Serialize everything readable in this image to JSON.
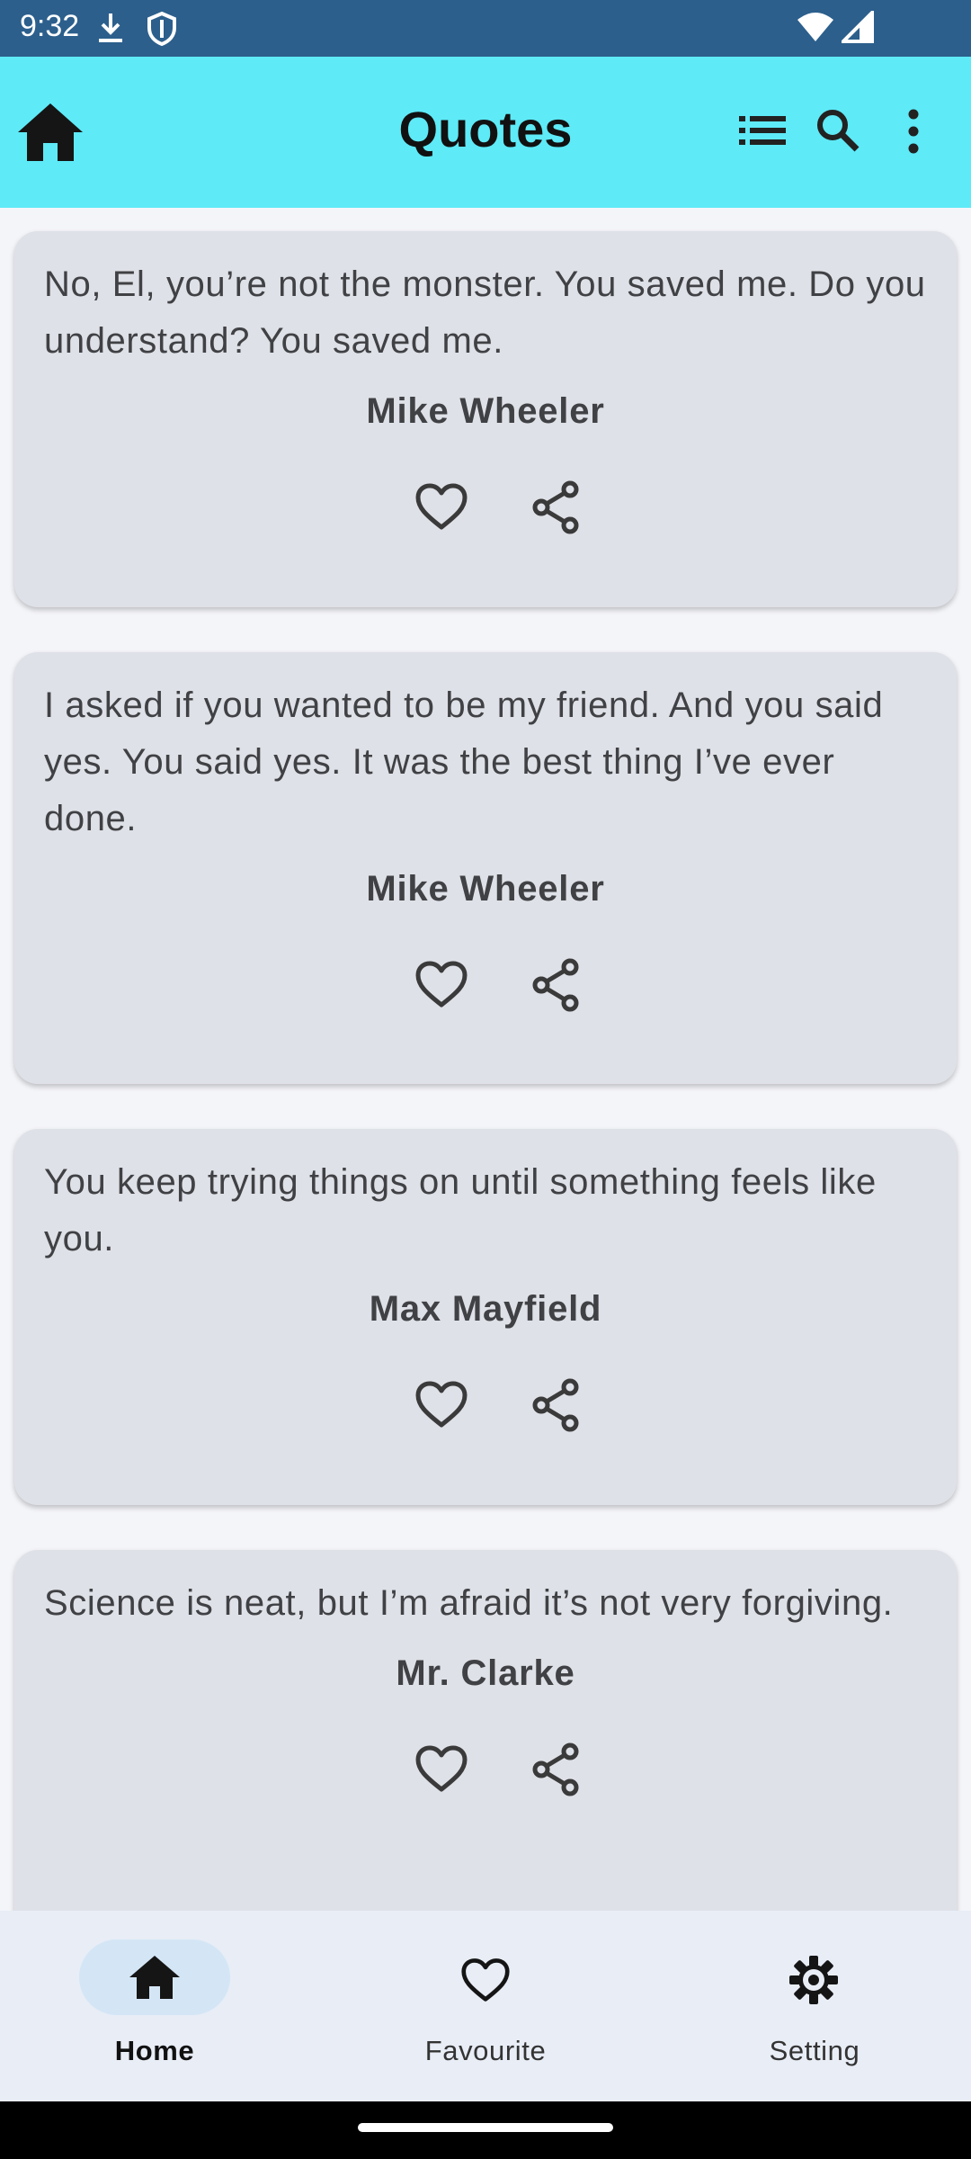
{
  "status_bar": {
    "time": "9:32",
    "icons": [
      "download-icon",
      "shield-icon",
      "wifi-icon",
      "signal-icon"
    ]
  },
  "app_bar": {
    "title": "Quotes",
    "icons": [
      "home-icon",
      "list-icon",
      "search-icon",
      "more-vert-icon"
    ],
    "background": "#5eeaf7"
  },
  "quotes": [
    {
      "text": "No, El, you’re not the monster. You saved me. Do you understand? You saved me.",
      "author": "Mike Wheeler"
    },
    {
      "text": "I asked if you wanted to be my friend. And you said yes. You said yes. It was the best thing I’ve ever done.",
      "author": "Mike Wheeler"
    },
    {
      "text": "You keep trying things on until something feels like you.",
      "author": "Max Mayfield"
    },
    {
      "text": "Science is neat, but I’m afraid it’s not very forgiving.",
      "author": "Mr. Clarke"
    }
  ],
  "bottom_nav": {
    "items": [
      {
        "label": "Home",
        "icon": "home-icon",
        "active": true
      },
      {
        "label": "Favourite",
        "icon": "heart-icon",
        "active": false
      },
      {
        "label": "Setting",
        "icon": "gear-icon",
        "active": false
      }
    ]
  },
  "colors": {
    "status_bar": "#2c5f8c",
    "card": "#dfe1e8",
    "nav_background": "#e8edf6",
    "nav_active_pill": "#d4e6f6"
  }
}
